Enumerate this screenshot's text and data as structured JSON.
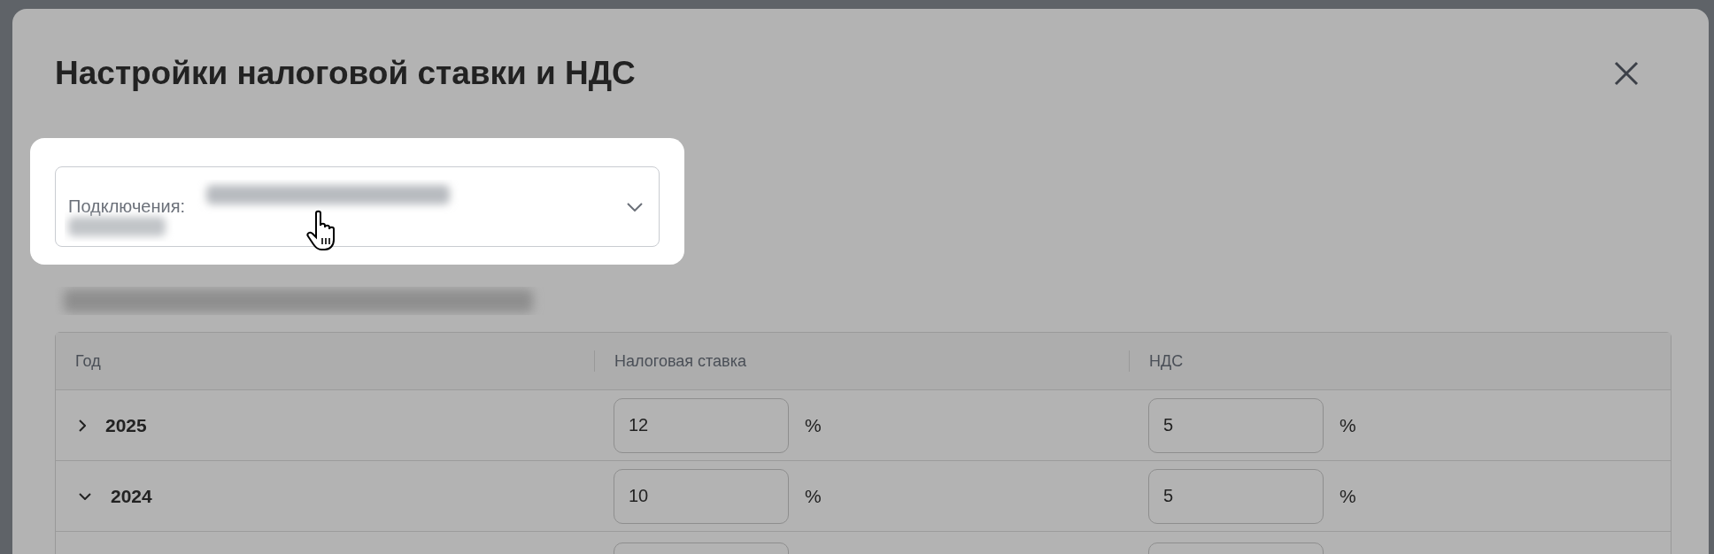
{
  "dialog": {
    "title": "Настройки налоговой ставки и НДС"
  },
  "connection_select": {
    "label": "Подключения:"
  },
  "table": {
    "columns": [
      "Год",
      "Налоговая ставка",
      "НДС"
    ],
    "rows": [
      {
        "year": "2025",
        "expanded": false,
        "tax_rate": "12",
        "tax_unit": "%",
        "vat": "5",
        "vat_unit": "%"
      },
      {
        "year": "2024",
        "expanded": true,
        "tax_rate": "10",
        "tax_unit": "%",
        "vat": "5",
        "vat_unit": "%"
      }
    ]
  }
}
